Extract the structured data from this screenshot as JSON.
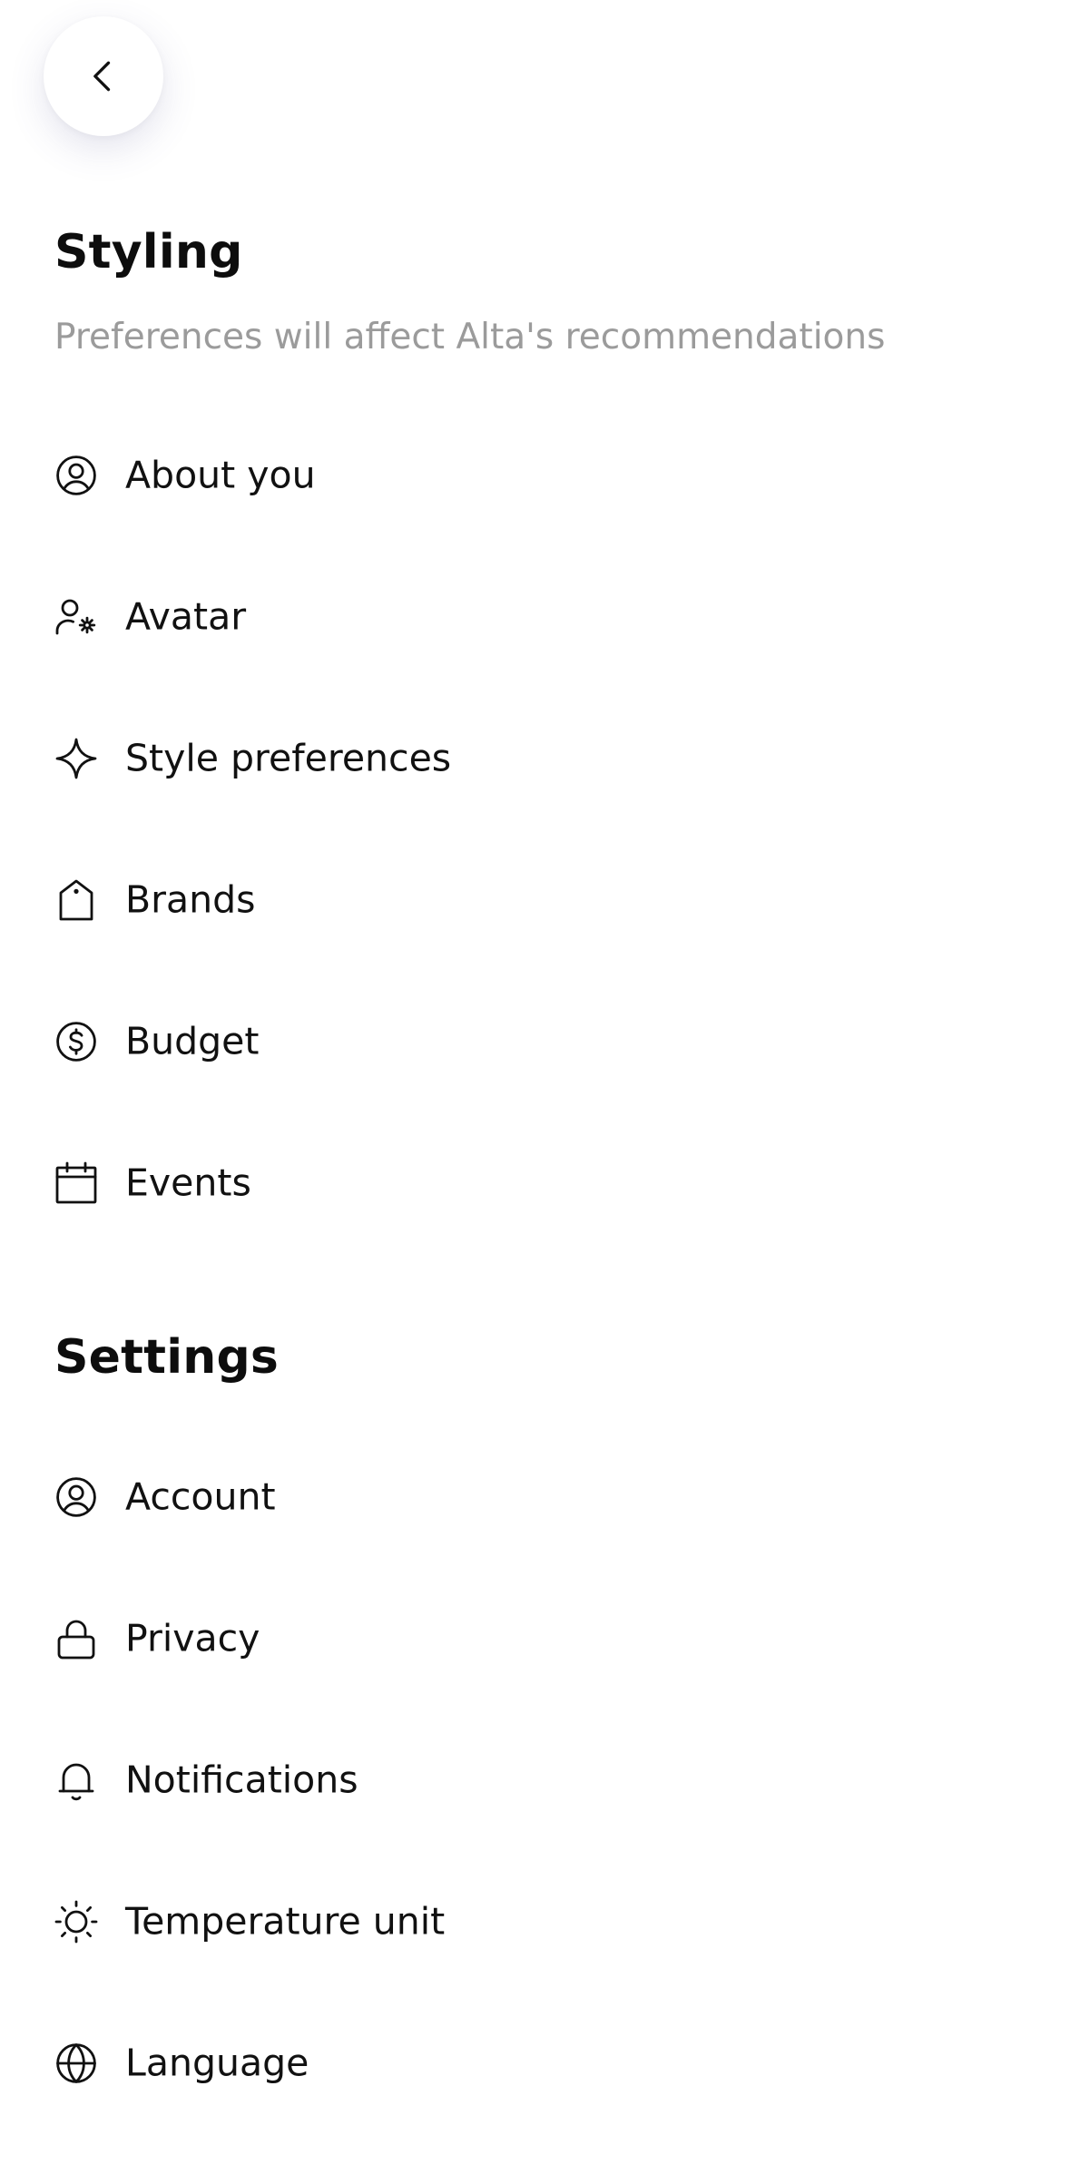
{
  "header": {
    "back_icon": "chevron-left-icon"
  },
  "styling": {
    "title": "Styling",
    "subtitle": "Preferences will affect Alta's recommendations",
    "items": [
      {
        "label": "About you",
        "icon": "user-circle-icon"
      },
      {
        "label": "Avatar",
        "icon": "user-settings-icon"
      },
      {
        "label": "Style preferences",
        "icon": "sparkle-icon"
      },
      {
        "label": "Brands",
        "icon": "tag-icon"
      },
      {
        "label": "Budget",
        "icon": "dollar-circle-icon"
      },
      {
        "label": "Events",
        "icon": "calendar-icon"
      }
    ]
  },
  "settings": {
    "title": "Settings",
    "items": [
      {
        "label": "Account",
        "icon": "user-circle-icon"
      },
      {
        "label": "Privacy",
        "icon": "lock-icon"
      },
      {
        "label": "Notifications",
        "icon": "bell-icon"
      },
      {
        "label": "Temperature unit",
        "icon": "sun-icon"
      },
      {
        "label": "Language",
        "icon": "globe-icon"
      }
    ]
  },
  "colors": {
    "text": "#111111",
    "muted": "#9b9b9b",
    "background": "#ffffff"
  }
}
